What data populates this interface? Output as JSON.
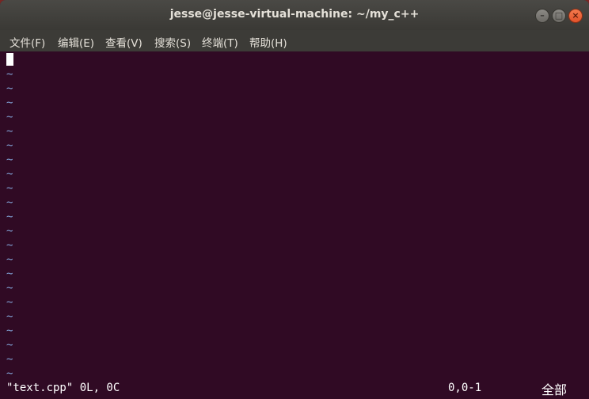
{
  "window": {
    "title": "jesse@jesse-virtual-machine: ~/my_c++",
    "buttons": {
      "minimize_icon": "minimize-icon",
      "maximize_icon": "maximize-icon",
      "close_icon": "close-icon"
    }
  },
  "menubar": {
    "items": [
      "文件(F)",
      "编辑(E)",
      "查看(V)",
      "搜索(S)",
      "终端(T)",
      "帮助(H)"
    ]
  },
  "editor": {
    "empty_line_marker": "~",
    "status_file": "\"text.cpp\" 0L, 0C",
    "status_position": "0,0-1",
    "status_scroll": "全部"
  },
  "colors": {
    "terminal_bg": "#300a24",
    "tilde": "#7f9ed1",
    "titlebar": "#3c3b37",
    "close_button": "#e3532b"
  }
}
